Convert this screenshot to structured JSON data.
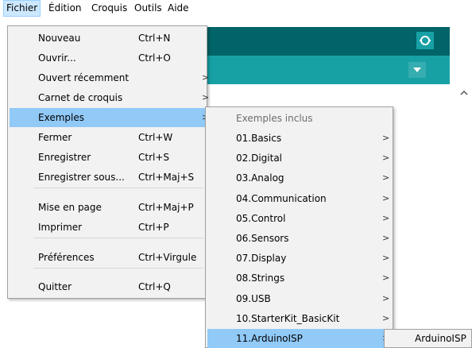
{
  "menubar": [
    "Fichier",
    "Édition",
    "Croquis",
    "Outils",
    "Aide"
  ],
  "icons": {
    "serial_monitor": "magnifier-icon",
    "tabs_menu": "dropdown-triangle-icon",
    "scroll_up": "scroll-up-arrow-icon"
  },
  "colors": {
    "toolbar": "#006468",
    "tabs": "#17a1a5",
    "highlight": "#91c9f7"
  },
  "fichier_menu": {
    "items": [
      {
        "label": "Nouveau",
        "shortcut": "Ctrl+N"
      },
      {
        "label": "Ouvrir...",
        "shortcut": "Ctrl+O"
      },
      {
        "label": "Ouvert récemment",
        "shortcut": "",
        "submenu": true
      },
      {
        "label": "Carnet de croquis",
        "shortcut": "",
        "submenu": true
      },
      {
        "label": "Exemples",
        "shortcut": "",
        "submenu": true,
        "highlighted": true
      },
      {
        "label": "Fermer",
        "shortcut": "Ctrl+W"
      },
      {
        "label": "Enregistrer",
        "shortcut": "Ctrl+S"
      },
      {
        "label": "Enregistrer sous...",
        "shortcut": "Ctrl+Maj+S"
      },
      {
        "label": "Mise en page",
        "shortcut": "Ctrl+Maj+P"
      },
      {
        "label": "Imprimer",
        "shortcut": "Ctrl+P"
      },
      {
        "label": "Préférences",
        "shortcut": "Ctrl+Virgule"
      },
      {
        "label": "Quitter",
        "shortcut": "Ctrl+Q"
      }
    ]
  },
  "exemples_menu": {
    "header": "Exemples inclus",
    "items": [
      {
        "label": "01.Basics"
      },
      {
        "label": "02.Digital"
      },
      {
        "label": "03.Analog"
      },
      {
        "label": "04.Communication"
      },
      {
        "label": "05.Control"
      },
      {
        "label": "06.Sensors"
      },
      {
        "label": "07.Display"
      },
      {
        "label": "08.Strings"
      },
      {
        "label": "09.USB"
      },
      {
        "label": "10.StarterKit_BasicKit"
      },
      {
        "label": "11.ArduinoISP",
        "highlighted": true
      }
    ]
  },
  "arduinoisp_menu": {
    "items": [
      {
        "label": "ArduinoISP"
      }
    ]
  },
  "arrow_glyph": ">"
}
